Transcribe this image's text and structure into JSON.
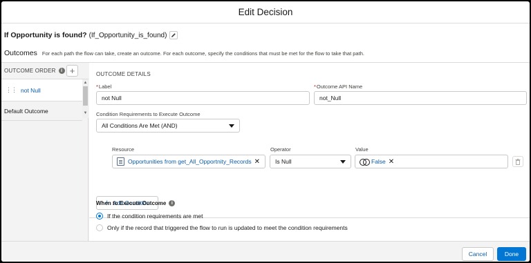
{
  "modal": {
    "title": "Edit Decision"
  },
  "decision": {
    "name": "If Opportunity is found?",
    "api_name": "(If_Opportunity_is_found)"
  },
  "outcomes": {
    "label": "Outcomes",
    "description": "For each path the flow can take, create an outcome. For each outcome, specify the conditions that must be met for the flow to take that path."
  },
  "outcome_order": {
    "header": "OUTCOME ORDER",
    "items": [
      {
        "label": "not Null",
        "selected": true
      }
    ],
    "default_label": "Default Outcome"
  },
  "details": {
    "section_title": "OUTCOME DETAILS",
    "label_field": {
      "label": "Label",
      "value": "not Null"
    },
    "api_field": {
      "label": "Outcome API Name",
      "value": "not_Null"
    },
    "requirements": {
      "label": "Condition Requirements to Execute Outcome",
      "value": "All Conditions Are Met (AND)"
    },
    "condition": {
      "resource_label": "Resource",
      "operator_label": "Operator",
      "value_label": "Value",
      "resource": "Opportunities from get_All_Opportnity_Records",
      "operator": "Is Null",
      "value": "False"
    },
    "add_condition": "Add Condition"
  },
  "when": {
    "title": "When to Execute Outcome",
    "options": [
      {
        "label": "If the condition requirements are met",
        "selected": true
      },
      {
        "label": "Only if the record that triggered the flow to run is updated to meet the condition requirements",
        "selected": false
      }
    ]
  },
  "footer": {
    "cancel": "Cancel",
    "done": "Done"
  },
  "colors": {
    "brand": "#0176d3",
    "link": "#0b5cab",
    "required": "#ba0517"
  }
}
